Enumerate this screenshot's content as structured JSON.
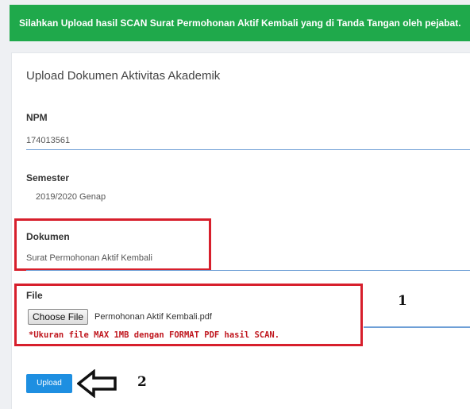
{
  "alert": {
    "text": "Silahkan Upload hasil SCAN Surat Permohonan Aktif Kembali yang di Tanda Tangan oleh pejabat."
  },
  "form": {
    "title": "Upload Dokumen Aktivitas Akademik",
    "npm": {
      "label": "NPM",
      "value": "174013561"
    },
    "semester": {
      "label": "Semester",
      "value": "2019/2020 Genap"
    },
    "dokumen": {
      "label": "Dokumen",
      "value": "Surat Permohonan Aktif Kembali"
    },
    "file": {
      "label": "File",
      "choose_label": "Choose File",
      "filename": "Permohonan Aktif Kembali.pdf",
      "note": "*Ukuran file MAX 1MB dengan FORMAT PDF hasil SCAN."
    },
    "upload_label": "Upload"
  },
  "annotations": {
    "marker_1": "1",
    "marker_2": "2"
  },
  "colors": {
    "alert": "#1fa94b",
    "highlight": "#d71f2c",
    "primary": "#1e8fe1"
  },
  "icons": {
    "pointer": "left-arrow-icon"
  }
}
